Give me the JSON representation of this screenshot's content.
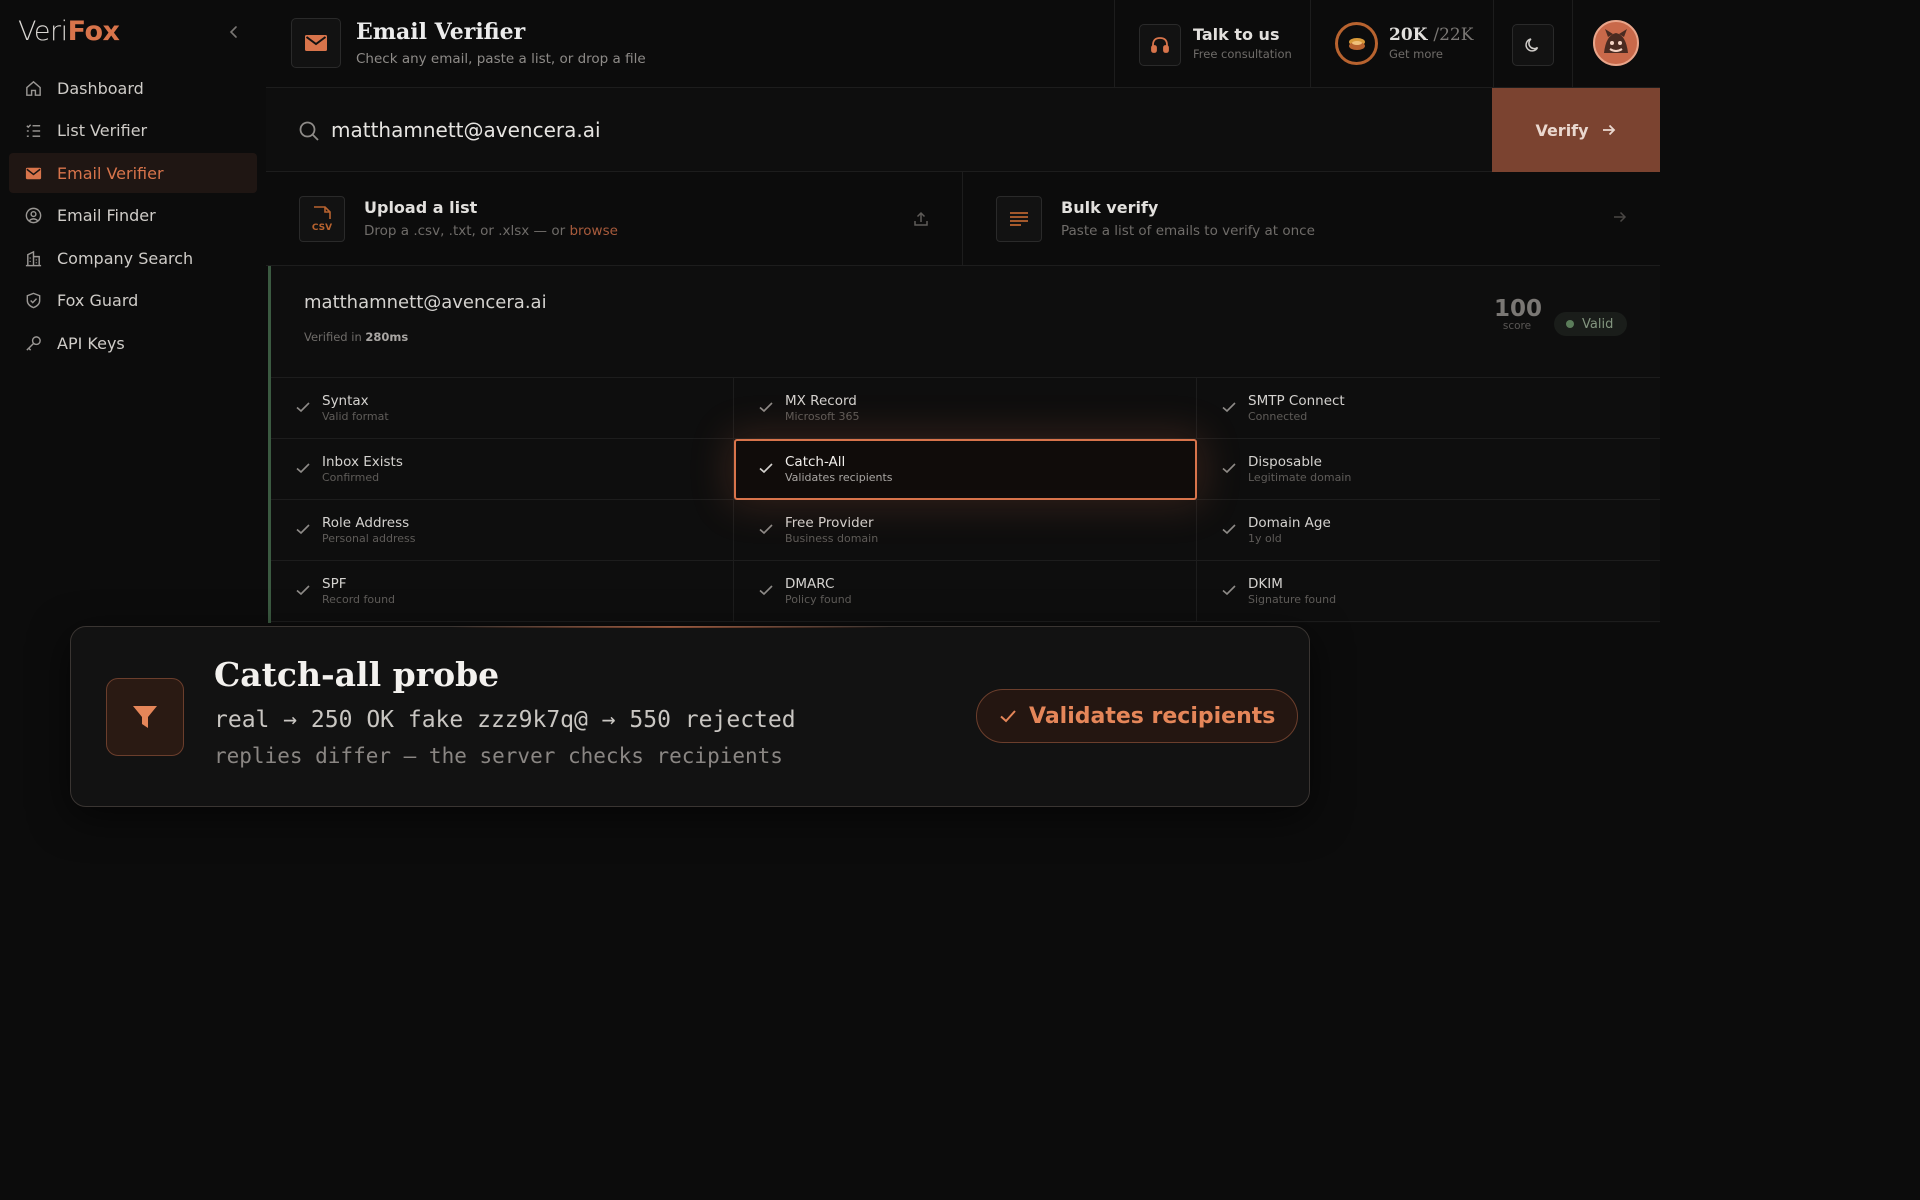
{
  "logo": {
    "part1": "Veri",
    "part2": "Fox"
  },
  "sidebar": {
    "items": [
      {
        "label": "Dashboard",
        "icon": "home-icon"
      },
      {
        "label": "List Verifier",
        "icon": "list-icon"
      },
      {
        "label": "Email Verifier",
        "icon": "mail-icon",
        "active": true
      },
      {
        "label": "Email Finder",
        "icon": "user-search-icon"
      },
      {
        "label": "Company Search",
        "icon": "building-icon"
      },
      {
        "label": "Fox Guard",
        "icon": "shield-icon"
      },
      {
        "label": "API Keys",
        "icon": "key-icon"
      }
    ]
  },
  "header": {
    "title": "Email Verifier",
    "subtitle": "Check any email, paste a list, or drop a file",
    "talk": {
      "title": "Talk to us",
      "subtitle": "Free consultation"
    },
    "credits": {
      "used": "20K",
      "total": "/22K",
      "subtitle": "Get more"
    }
  },
  "search": {
    "value": "matthamnett@avencera.ai",
    "button": "Verify"
  },
  "upload": {
    "title": "Upload a list",
    "subtitle_prefix": "Drop a .csv, .txt, or .xlsx — or ",
    "browse": "browse",
    "icon_text": "CSV"
  },
  "bulk": {
    "title": "Bulk verify",
    "subtitle": "Paste a list of emails to verify at once"
  },
  "result": {
    "email": "matthamnett@avencera.ai",
    "time_prefix": "Verified in ",
    "time": "280ms",
    "score": "100",
    "score_label": "score",
    "status": "Valid"
  },
  "checks": [
    [
      {
        "title": "Syntax",
        "sub": "Valid format"
      },
      {
        "title": "MX Record",
        "sub": "Microsoft 365"
      },
      {
        "title": "SMTP Connect",
        "sub": "Connected"
      }
    ],
    [
      {
        "title": "Inbox Exists",
        "sub": "Confirmed"
      },
      {
        "title": "Catch-All",
        "sub": "Validates recipients"
      },
      {
        "title": "Disposable",
        "sub": "Legitimate domain"
      }
    ],
    [
      {
        "title": "Role Address",
        "sub": "Personal address"
      },
      {
        "title": "Free Provider",
        "sub": "Business domain"
      },
      {
        "title": "Domain Age",
        "sub": "1y old"
      }
    ],
    [
      {
        "title": "SPF",
        "sub": "Record found"
      },
      {
        "title": "DMARC",
        "sub": "Policy found"
      },
      {
        "title": "DKIM",
        "sub": "Signature found"
      }
    ]
  ],
  "popup": {
    "title": "Catch-all probe",
    "line1": "real → 250 OK fake zzz9k7q@ → 550 rejected",
    "line2": "replies differ — the server checks recipients",
    "badge": "Validates recipients"
  },
  "colors": {
    "accent": "#d8744b",
    "valid": "#5b7d5a",
    "background": "#0c0c0c"
  }
}
